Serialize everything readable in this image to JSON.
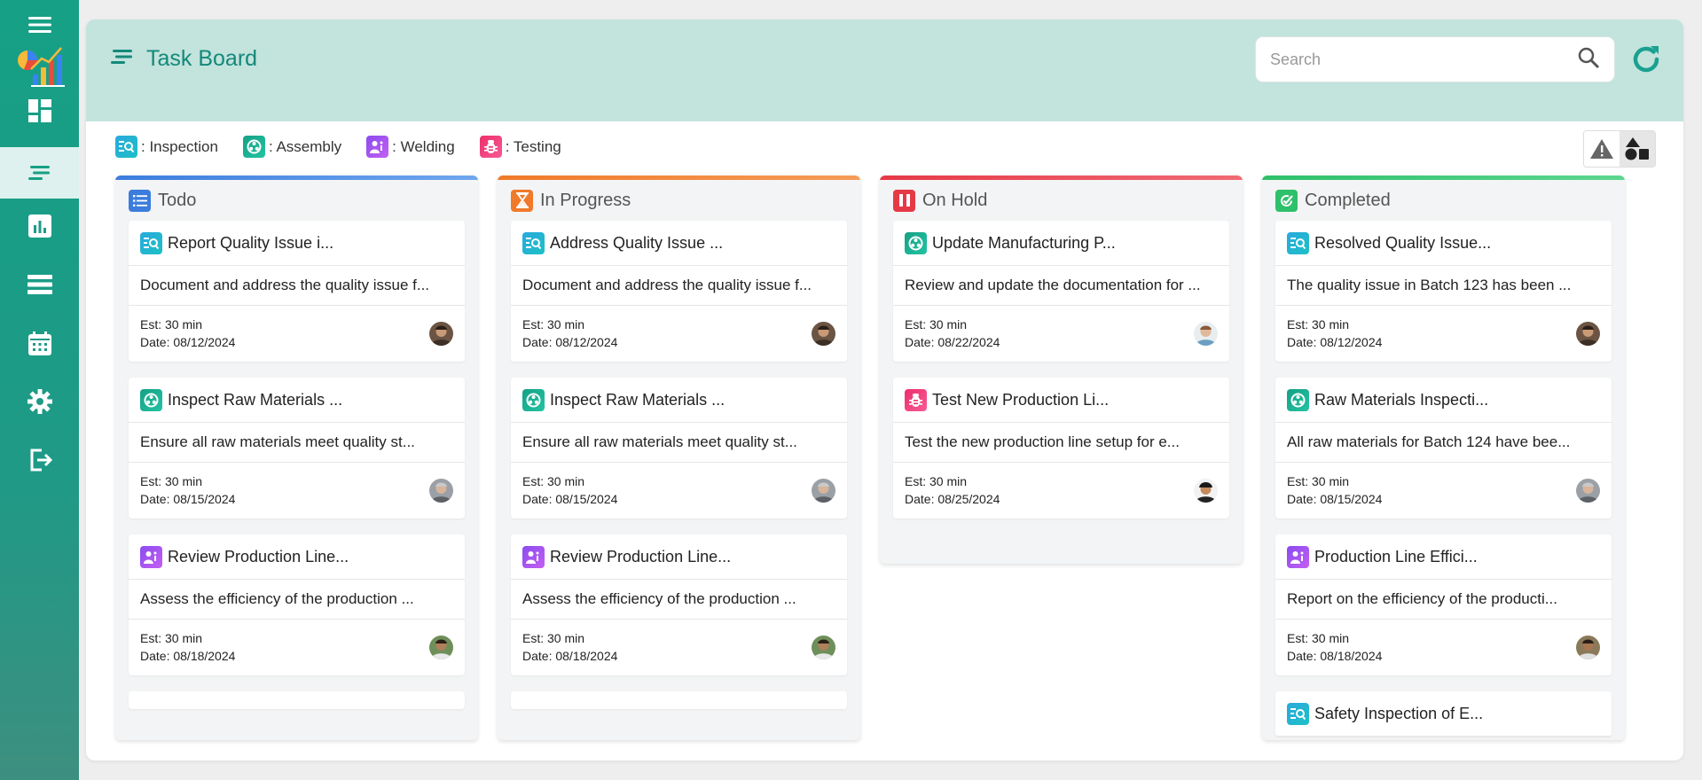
{
  "header": {
    "title": "Task Board",
    "search_placeholder": "Search"
  },
  "legend": [
    {
      "type": "inspection",
      "label": ": Inspection"
    },
    {
      "type": "assembly",
      "label": ": Assembly"
    },
    {
      "type": "welding",
      "label": ": Welding"
    },
    {
      "type": "testing",
      "label": ": Testing"
    }
  ],
  "columns": {
    "todo": {
      "title": "Todo",
      "color": "#3b7ddd",
      "cards": [
        {
          "type": "inspection",
          "title": "Report Quality Issue i...",
          "desc": "Document and address the quality issue f...",
          "est": "Est: 30 min",
          "date": "Date: 08/12/2024"
        },
        {
          "type": "assembly",
          "title": "Inspect Raw Materials ...",
          "desc": "Ensure all raw materials meet quality st...",
          "est": "Est: 30 min",
          "date": "Date: 08/15/2024"
        },
        {
          "type": "welding",
          "title": "Review Production Line...",
          "desc": "Assess the efficiency of the production ...",
          "est": "Est: 30 min",
          "date": "Date: 08/18/2024"
        }
      ]
    },
    "in_progress": {
      "title": "In Progress",
      "color": "#f07a2a",
      "cards": [
        {
          "type": "inspection",
          "title": "Address Quality Issue ...",
          "desc": "Document and address the quality issue f...",
          "est": "Est: 30 min",
          "date": "Date: 08/12/2024"
        },
        {
          "type": "assembly",
          "title": "Inspect Raw Materials ...",
          "desc": "Ensure all raw materials meet quality st...",
          "est": "Est: 30 min",
          "date": "Date: 08/15/2024"
        },
        {
          "type": "welding",
          "title": "Review Production Line...",
          "desc": "Assess the efficiency of the production ...",
          "est": "Est: 30 min",
          "date": "Date: 08/18/2024"
        }
      ]
    },
    "on_hold": {
      "title": "On Hold",
      "color": "#e63946",
      "cards": [
        {
          "type": "assembly",
          "title": "Update Manufacturing P...",
          "desc": "Review and update the documentation for ...",
          "est": "Est: 30 min",
          "date": "Date: 08/22/2024"
        },
        {
          "type": "testing",
          "title": "Test New Production Li...",
          "desc": "Test the new production line setup for e...",
          "est": "Est: 30 min",
          "date": "Date: 08/25/2024"
        }
      ]
    },
    "completed": {
      "title": "Completed",
      "color": "#2ec06b",
      "cards": [
        {
          "type": "inspection",
          "title": "Resolved Quality Issue...",
          "desc": "The quality issue in Batch 123 has been ...",
          "est": "Est: 30 min",
          "date": "Date: 08/12/2024"
        },
        {
          "type": "assembly",
          "title": "Raw Materials Inspecti...",
          "desc": "All raw materials for Batch 124 have bee...",
          "est": "Est: 30 min",
          "date": "Date: 08/15/2024"
        },
        {
          "type": "welding",
          "title": "Production Line Effici...",
          "desc": "Report on the efficiency of the producti...",
          "est": "Est: 30 min",
          "date": "Date: 08/18/2024"
        },
        {
          "type": "inspection",
          "title": "Safety Inspection of E...",
          "desc": "",
          "est": "",
          "date": ""
        }
      ]
    }
  },
  "icons": {
    "sidebar": [
      "menu-icon",
      "app-logo",
      "dashboard-icon",
      "task-board-icon",
      "bar-chart-icon",
      "list-icon",
      "calendar-icon",
      "gear-icon",
      "logout-icon"
    ],
    "types": {
      "inspection": "inspection-icon",
      "assembly": "assembly-icon",
      "welding": "welding-icon",
      "testing": "testing-icon"
    }
  },
  "colors": {
    "sidebar": "#16a085",
    "header": "#c3e3dd",
    "accent": "#13897a"
  }
}
